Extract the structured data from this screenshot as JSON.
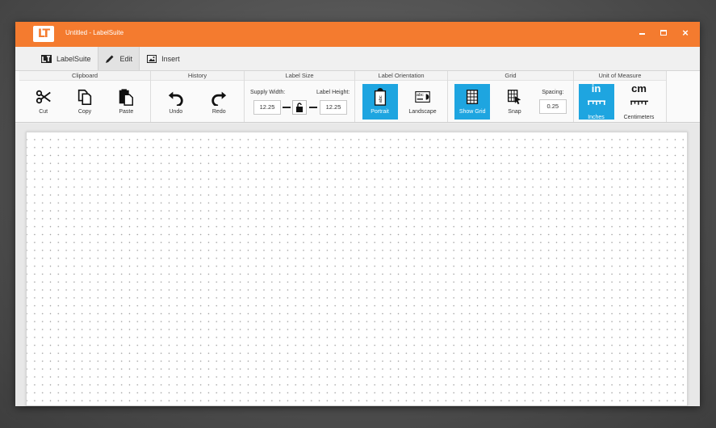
{
  "window": {
    "title": "Untitled - LabelSuite",
    "logo_text": "LT",
    "brand_color": "#f47b2f",
    "controls": {
      "minimize": "minimize",
      "maximize": "maximize",
      "close": "×"
    }
  },
  "tabs": [
    {
      "label": "LabelSuite",
      "icon": "labelsuite-logo-icon",
      "active": false
    },
    {
      "label": "Edit",
      "icon": "pencil-icon",
      "active": true
    },
    {
      "label": "Insert",
      "icon": "image-icon",
      "active": false
    }
  ],
  "ribbon": {
    "clipboard": {
      "title": "Clipboard",
      "cut": "Cut",
      "copy": "Copy",
      "paste": "Paste"
    },
    "history": {
      "title": "History",
      "undo": "Undo",
      "redo": "Redo"
    },
    "label_size": {
      "title": "Label Size",
      "supply_width_label": "Supply Width:",
      "supply_width_value": "12.25",
      "label_height_label": "Label Height:",
      "label_height_value": "12.25",
      "lock_icon": "unlocked-padlock-icon"
    },
    "label_orientation": {
      "title": "Label Orientation",
      "portrait": "Portrait",
      "landscape": "Landscape",
      "selected": "Portrait"
    },
    "grid": {
      "title": "Grid",
      "show_grid": "Show Grid",
      "snap": "Snap",
      "spacing_label": "Spacing:",
      "spacing_value": "0.25",
      "show_grid_active": true
    },
    "unit_of_measure": {
      "title": "Unit of Measure",
      "inches": "Inches",
      "inches_icon_text": "in",
      "centimeters": "Centimeters",
      "centimeters_icon_text": "cm",
      "selected": "Inches"
    },
    "accent_color": "#1ea5e0"
  }
}
